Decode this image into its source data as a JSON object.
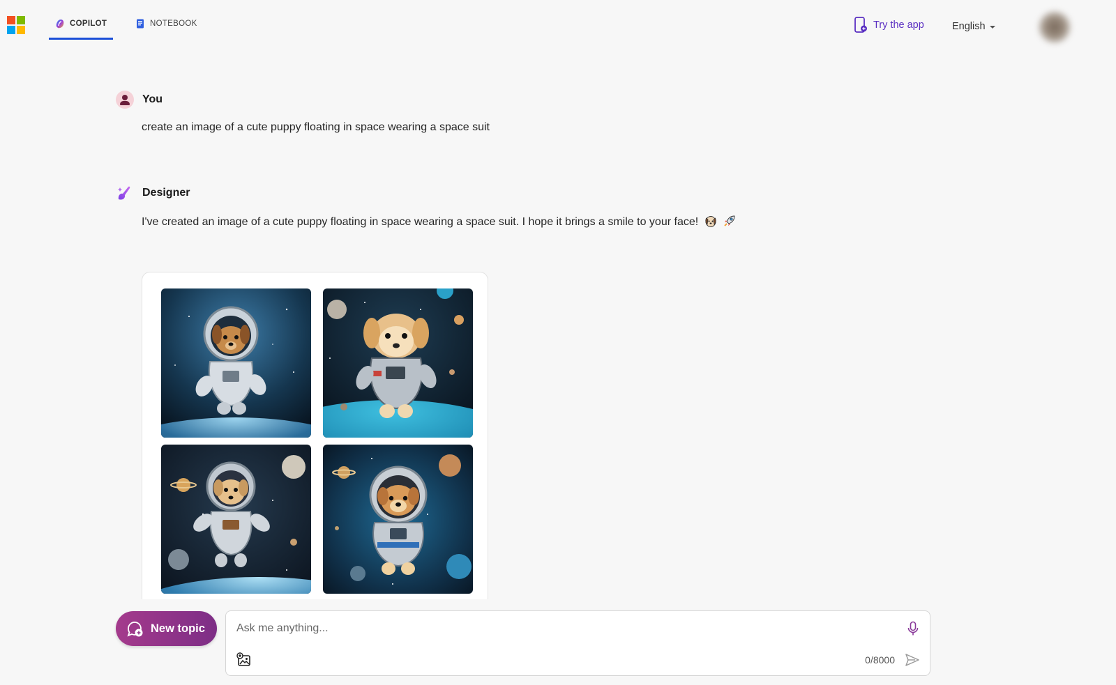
{
  "header": {
    "tabs": [
      {
        "label": "COPILOT",
        "active": true
      },
      {
        "label": "NOTEBOOK",
        "active": false
      }
    ],
    "try_app_label": "Try the app",
    "language": "English"
  },
  "conversation": {
    "user": {
      "name": "You",
      "message": "create an image of a cute puppy floating in space wearing a space suit"
    },
    "designer": {
      "name": "Designer",
      "message": "I've created an image of a cute puppy floating in space wearing a space suit. I hope it brings a smile to your face!",
      "emojis": [
        "dog-face-icon",
        "rocket-icon"
      ],
      "images": [
        {
          "subject": "puppy in white space suit floating above Earth"
        },
        {
          "subject": "golden puppy in space suit near planets"
        },
        {
          "subject": "puppy astronaut with Saturn and moon"
        },
        {
          "subject": "fluffy puppy in helmet among planets"
        }
      ]
    }
  },
  "composer": {
    "new_topic_label": "New topic",
    "placeholder": "Ask me anything...",
    "counter": "0/8000"
  },
  "colors": {
    "accent_blue": "#1b4fd8",
    "try_app_purple": "#5a2fc2",
    "new_topic_gradient_start": "#a43a8c",
    "new_topic_gradient_end": "#7d2e86",
    "background": "#f7f7f7"
  }
}
